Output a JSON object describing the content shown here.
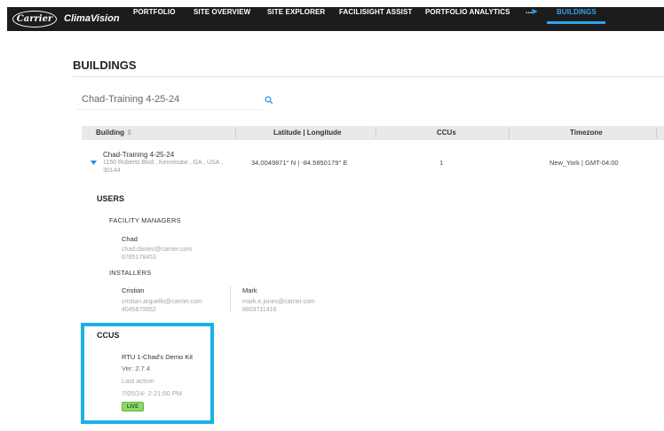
{
  "nav": {
    "logo_text": "Carrier",
    "brand": "ClimaVision",
    "items": [
      {
        "label": "PORTFOLIO"
      },
      {
        "label": "SITE OVERVIEW"
      },
      {
        "label": "SITE EXPLORER"
      },
      {
        "label": "FACILISIGHT ASSIST"
      },
      {
        "label": "PORTFOLIO ANALYTICS"
      }
    ],
    "more_label": "...",
    "active_label": "BUILDINGS",
    "accent_color": "#2ea3f2"
  },
  "page": {
    "title": "BUILDINGS"
  },
  "search": {
    "value": "Chad-Training 4-25-24",
    "icon": "search-icon"
  },
  "table": {
    "headers": {
      "building": "Building",
      "latlng": "Latitude | Longitude",
      "ccus": "CCUs",
      "timezone": "Timezone"
    },
    "row": {
      "name": "Chad-Training 4-25-24",
      "address": "1150 Roberts Blvd , Kennesaw , GA , USA , 30144",
      "latlng": "34.0049871° N | -84.5850179° E",
      "ccus": "1",
      "timezone": "New_York | GMT-04:00"
    }
  },
  "users": {
    "title": "USERS",
    "facility_managers_title": "FACILITY MANAGERS",
    "facility_managers": [
      {
        "name": "Chad",
        "email": "chad.davies@carrier.com",
        "phone": "6785178453"
      }
    ],
    "installers_title": "INSTALLERS",
    "installers": [
      {
        "name": "Cristian",
        "email": "cristian.arguello@carrier.com",
        "phone": "4045870652"
      },
      {
        "name": "Mark",
        "email": "mark.e.jones@carrier.com",
        "phone": "8603711418"
      }
    ]
  },
  "ccus": {
    "title": "CCUS",
    "name": "RTU 1-Chad's Demo Kit",
    "version": "Ver: 2.7.4",
    "last_active_label": "Last active:",
    "last_active": "7/05/24- 2:21:00 PM",
    "status": "LIVE",
    "highlight_color": "#1ab0e6",
    "status_color": "#8cd96b"
  }
}
